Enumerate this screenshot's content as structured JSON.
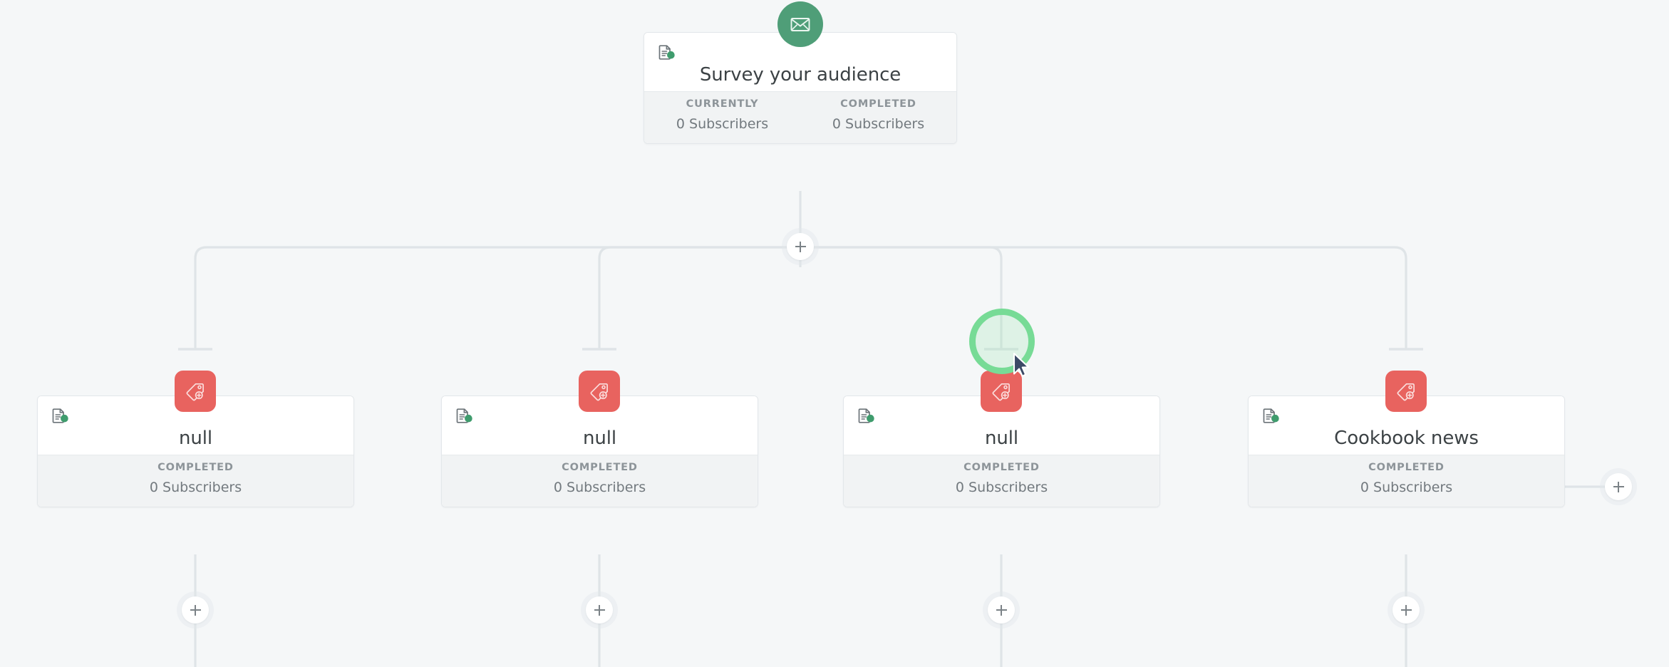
{
  "colors": {
    "canvas_bg": "#f5f7f8",
    "card_bg": "#ffffff",
    "card_footer_bg": "#f1f3f4",
    "card_border": "#e3e7ea",
    "wire": "#dfe4e7",
    "email_badge": "#4f9e78",
    "tag_badge": "#e8635f",
    "title_text": "#3c4245",
    "label_text": "#8d9499",
    "value_text": "#72797e",
    "highlight_ring": "#77db96"
  },
  "root_node": {
    "id": "survey-your-audience",
    "title": "Survey your audience",
    "badge_icon": "envelope-icon",
    "status_icon": "document-active-icon",
    "stats": [
      {
        "label": "CURRENTLY",
        "value": "0 Subscribers"
      },
      {
        "label": "COMPLETED",
        "value": "0 Subscribers"
      }
    ]
  },
  "child_nodes": [
    {
      "id": "child-1",
      "title": "null",
      "badge_icon": "tag-plus-icon",
      "status_icon": "document-active-icon",
      "stats": [
        {
          "label": "COMPLETED",
          "value": "0 Subscribers"
        }
      ]
    },
    {
      "id": "child-2",
      "title": "null",
      "badge_icon": "tag-plus-icon",
      "status_icon": "document-active-icon",
      "stats": [
        {
          "label": "COMPLETED",
          "value": "0 Subscribers"
        }
      ]
    },
    {
      "id": "child-3",
      "title": "null",
      "badge_icon": "tag-plus-icon",
      "status_icon": "document-active-icon",
      "stats": [
        {
          "label": "COMPLETED",
          "value": "0 Subscribers"
        }
      ]
    },
    {
      "id": "child-4",
      "title": "Cookbook news",
      "badge_icon": "tag-plus-icon",
      "status_icon": "document-active-icon",
      "stats": [
        {
          "label": "COMPLETED",
          "value": "0 Subscribers"
        }
      ]
    }
  ],
  "add_buttons": [
    {
      "id": "add-branch-root",
      "icon": "plus-icon"
    },
    {
      "id": "add-step-child-1",
      "icon": "plus-icon"
    },
    {
      "id": "add-step-child-2",
      "icon": "plus-icon"
    },
    {
      "id": "add-step-child-3",
      "icon": "plus-icon"
    },
    {
      "id": "add-step-child-4",
      "icon": "plus-icon"
    },
    {
      "id": "add-branch-right",
      "icon": "plus-icon"
    }
  ],
  "pointer": {
    "cursor_icon": "arrow-cursor",
    "highlight": "click-highlight-ring"
  }
}
